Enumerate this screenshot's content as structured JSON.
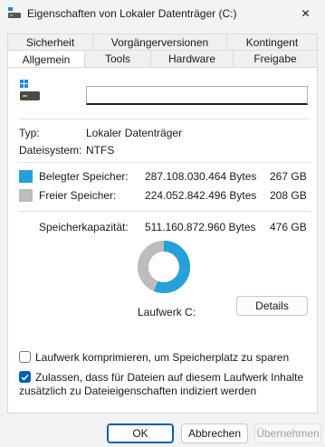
{
  "window": {
    "title": "Eigenschaften von Lokaler Datenträger (C:)",
    "close_glyph": "✕"
  },
  "tabs_row1": [
    {
      "label": "Sicherheit"
    },
    {
      "label": "Vorgängerversionen"
    },
    {
      "label": "Kontingent"
    }
  ],
  "tabs_row2": [
    {
      "label": "Allgemein",
      "active": true
    },
    {
      "label": "Tools"
    },
    {
      "label": "Hardware"
    },
    {
      "label": "Freigabe"
    }
  ],
  "general": {
    "name_value": "",
    "type_label": "Typ:",
    "type_value": "Lokaler Datenträger",
    "fs_label": "Dateisystem:",
    "fs_value": "NTFS",
    "used_label": "Belegter Speicher:",
    "used_bytes": "287.108.030.464 Bytes",
    "used_size": "267 GB",
    "free_label": "Freier Speicher:",
    "free_bytes": "224.052.842.496 Bytes",
    "free_size": "208 GB",
    "capacity_label": "Speicherkapazität:",
    "capacity_bytes": "511.160.872.960 Bytes",
    "capacity_size": "476 GB",
    "drive_label": "Laufwerk C:",
    "details_button": "Details",
    "compress_label": "Laufwerk komprimieren, um Speicherplatz zu sparen",
    "compress_checked": false,
    "index_label_line1": "Zulassen, dass für Dateien auf diesem Laufwerk Inhalte",
    "index_label_line2": "zusätzlich zu Dateieigenschaften indiziert werden",
    "index_checked": true
  },
  "usage": {
    "used_fraction": 0.5617,
    "used_color": "#26a0da",
    "free_color": "#bcbcbc"
  },
  "footer": {
    "ok": "OK",
    "cancel": "Abbrechen",
    "apply": "Übernehmen"
  }
}
